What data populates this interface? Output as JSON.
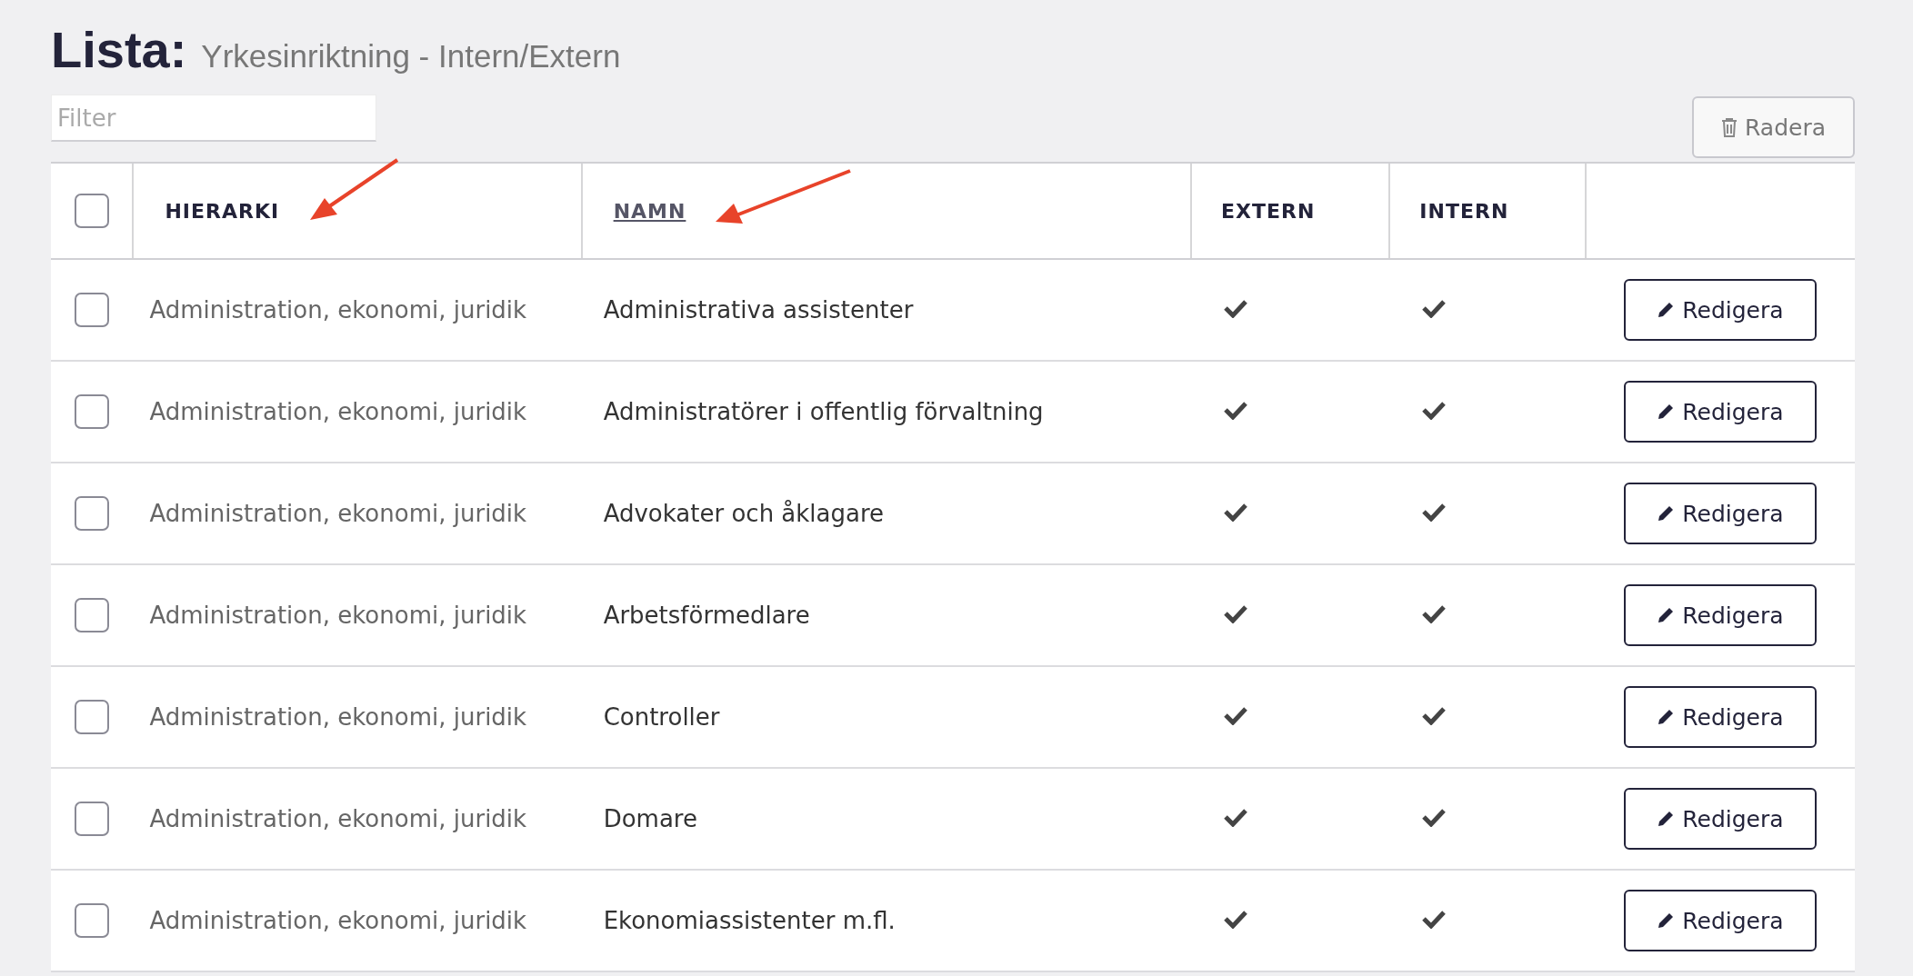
{
  "page_title": {
    "label": "Lista:",
    "subtitle": "Yrkesinriktning - Intern/Extern"
  },
  "filter": {
    "placeholder": "Filter"
  },
  "delete_button": {
    "label": "Radera"
  },
  "table": {
    "select_all": {
      "checked": false
    },
    "columns": [
      {
        "label": "HIERARKI",
        "sortable": false,
        "marked": true
      },
      {
        "label": "NAMN",
        "sortable": true,
        "marked": true
      },
      {
        "label": "EXTERN",
        "sortable": false,
        "marked": false
      },
      {
        "label": "INTERN",
        "sortable": false,
        "marked": false
      }
    ],
    "rows": [
      {
        "checked": false,
        "hierarki": "Administration, ekonomi, juridik",
        "namn": "Administrativa assistenter",
        "extern": true,
        "intern": true,
        "action": "Redigera"
      },
      {
        "checked": false,
        "hierarki": "Administration, ekonomi, juridik",
        "namn": "Administratörer i offentlig förvaltning",
        "extern": true,
        "intern": true,
        "action": "Redigera"
      },
      {
        "checked": false,
        "hierarki": "Administration, ekonomi, juridik",
        "namn": "Advokater och åklagare",
        "extern": true,
        "intern": true,
        "action": "Redigera"
      },
      {
        "checked": false,
        "hierarki": "Administration, ekonomi, juridik",
        "namn": "Arbetsförmedlare",
        "extern": true,
        "intern": true,
        "action": "Redigera"
      },
      {
        "checked": false,
        "hierarki": "Administration, ekonomi, juridik",
        "namn": "Controller",
        "extern": true,
        "intern": true,
        "action": "Redigera"
      },
      {
        "checked": false,
        "hierarki": "Administration, ekonomi, juridik",
        "namn": "Domare",
        "extern": true,
        "intern": true,
        "action": "Redigera"
      },
      {
        "checked": false,
        "hierarki": "Administration, ekonomi, juridik",
        "namn": "Ekonomiassistenter m.fl.",
        "extern": true,
        "intern": true,
        "action": "Redigera"
      }
    ]
  }
}
